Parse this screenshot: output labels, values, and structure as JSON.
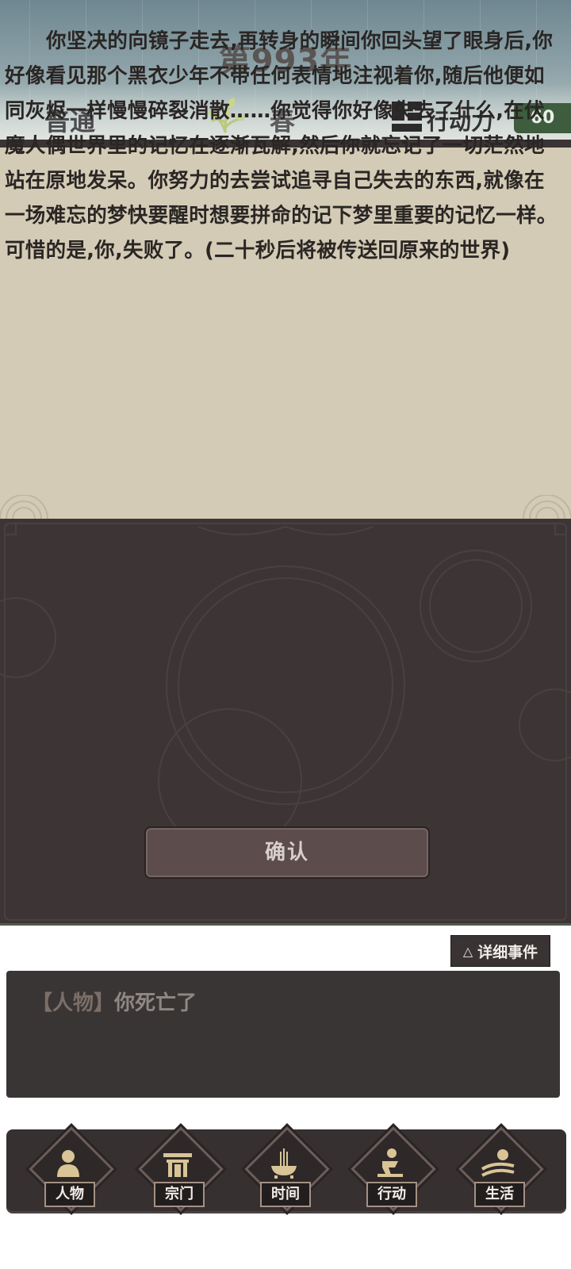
{
  "header": {
    "year_title": "第993年",
    "difficulty": "普通",
    "season": "春",
    "action_points_label": "行动力",
    "action_points_value": "60"
  },
  "story": {
    "text": "你坚决的向镜子走去,再转身的瞬间你回头望了眼身后,你好像看见那个黑衣少年不带任何表情地注视着你,随后他便如同灰烬一样慢慢碎裂消散……你觉得你好像失去了什么,在伏魔人偶世界里的记忆在逐渐瓦解,然后你就忘记了一切茫然地站在原地发呆。你努力的去尝试追寻自己失去的东西,就像在一场难忘的梦快要醒时想要拼命的记下梦里重要的记忆一样。可惜的是,你,失败了。(二十秒后将被传送回原来的世界)"
  },
  "dialog": {
    "confirm_label": "确认"
  },
  "event_log": {
    "details_label": "详细事件",
    "details_icon": "triangle-up-icon",
    "entries": [
      {
        "tag": "【人物】",
        "message": "你死亡了"
      }
    ]
  },
  "nav": {
    "items": [
      {
        "label": "人物",
        "icon": "person-icon"
      },
      {
        "label": "宗门",
        "icon": "sect-gate-icon"
      },
      {
        "label": "时间",
        "icon": "incense-burner-icon"
      },
      {
        "label": "行动",
        "icon": "action-figure-icon"
      },
      {
        "label": "生活",
        "icon": "landscape-sun-icon"
      }
    ]
  },
  "colors": {
    "story_bg": "#d4cbb6",
    "dark_panel_bg": "#3d3535",
    "action_points_bg": "#3e5c3e",
    "confirm_button_bg": "#5c4c4c"
  }
}
